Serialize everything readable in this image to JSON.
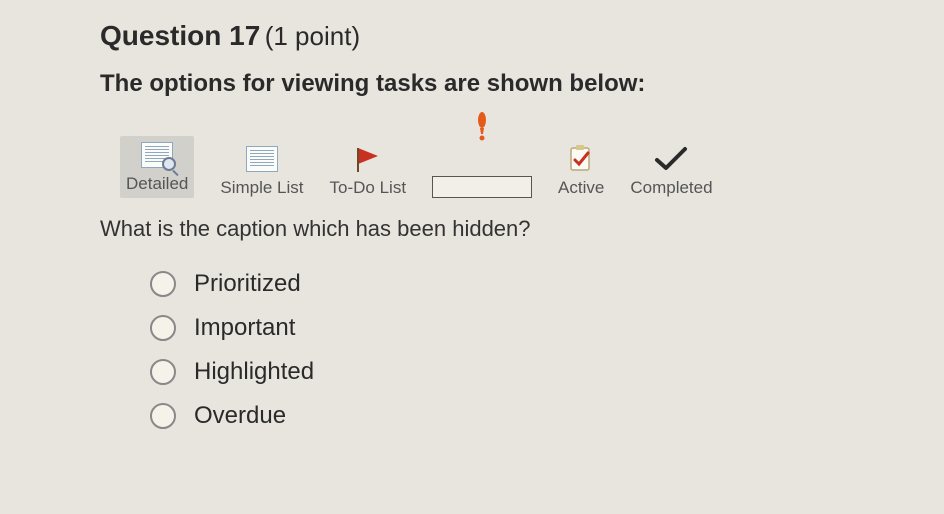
{
  "question_title": "Question 17",
  "points": "(1 point)",
  "intro": "The options for viewing tasks are shown below:",
  "toolbar": {
    "view1": "Detailed",
    "view2": "Simple List",
    "view3": "To-Do List",
    "view4_hidden": "",
    "view5": "Active",
    "view6": "Completed"
  },
  "prompt": "What is the caption which has been hidden?",
  "options": {
    "a": "Prioritized",
    "b": "Important",
    "c": "Highlighted",
    "d": "Overdue"
  }
}
